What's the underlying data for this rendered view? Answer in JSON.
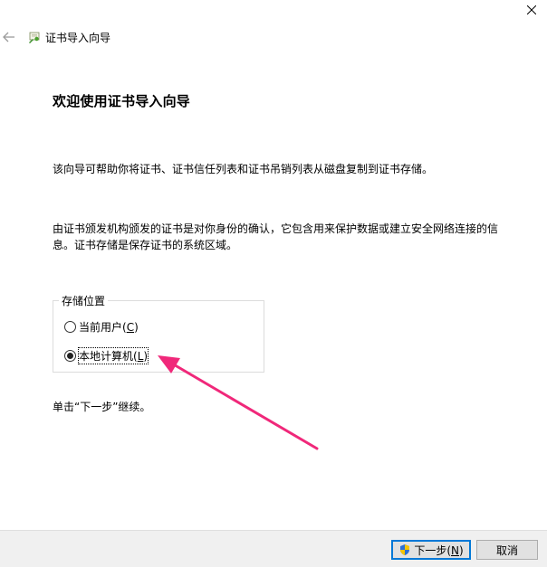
{
  "window": {
    "title": "证书导入向导"
  },
  "page": {
    "heading": "欢迎使用证书导入向导",
    "intro": "该向导可帮助你将证书、证书信任列表和证书吊销列表从磁盘复制到证书存储。",
    "description_line1": "由证书颁发机构颁发的证书是对你身份的确认，它包含用来保护数据或建立安全网络连接的信",
    "description_line2": "息。证书存储是保存证书的系统区域。",
    "continue_hint": "单击“下一步”继续。"
  },
  "store_location": {
    "legend": "存储位置",
    "options": [
      {
        "label": "当前用户(",
        "hotkey": "C",
        "suffix": ")",
        "selected": false
      },
      {
        "label": "本地计算机(",
        "hotkey": "L",
        "suffix": ")",
        "selected": true
      }
    ]
  },
  "footer": {
    "next_label": "下一步(",
    "next_hotkey": "N",
    "next_suffix": ")",
    "cancel_label": "取消"
  },
  "icons": {
    "close": "close-icon",
    "back": "back-arrow-icon",
    "wizard": "certificate-wizard-icon",
    "shield": "uac-shield-icon"
  },
  "colors": {
    "annotation_arrow": "#f0287a",
    "default_button_border": "#0078d7",
    "footer_bg": "#f0f0f0"
  }
}
